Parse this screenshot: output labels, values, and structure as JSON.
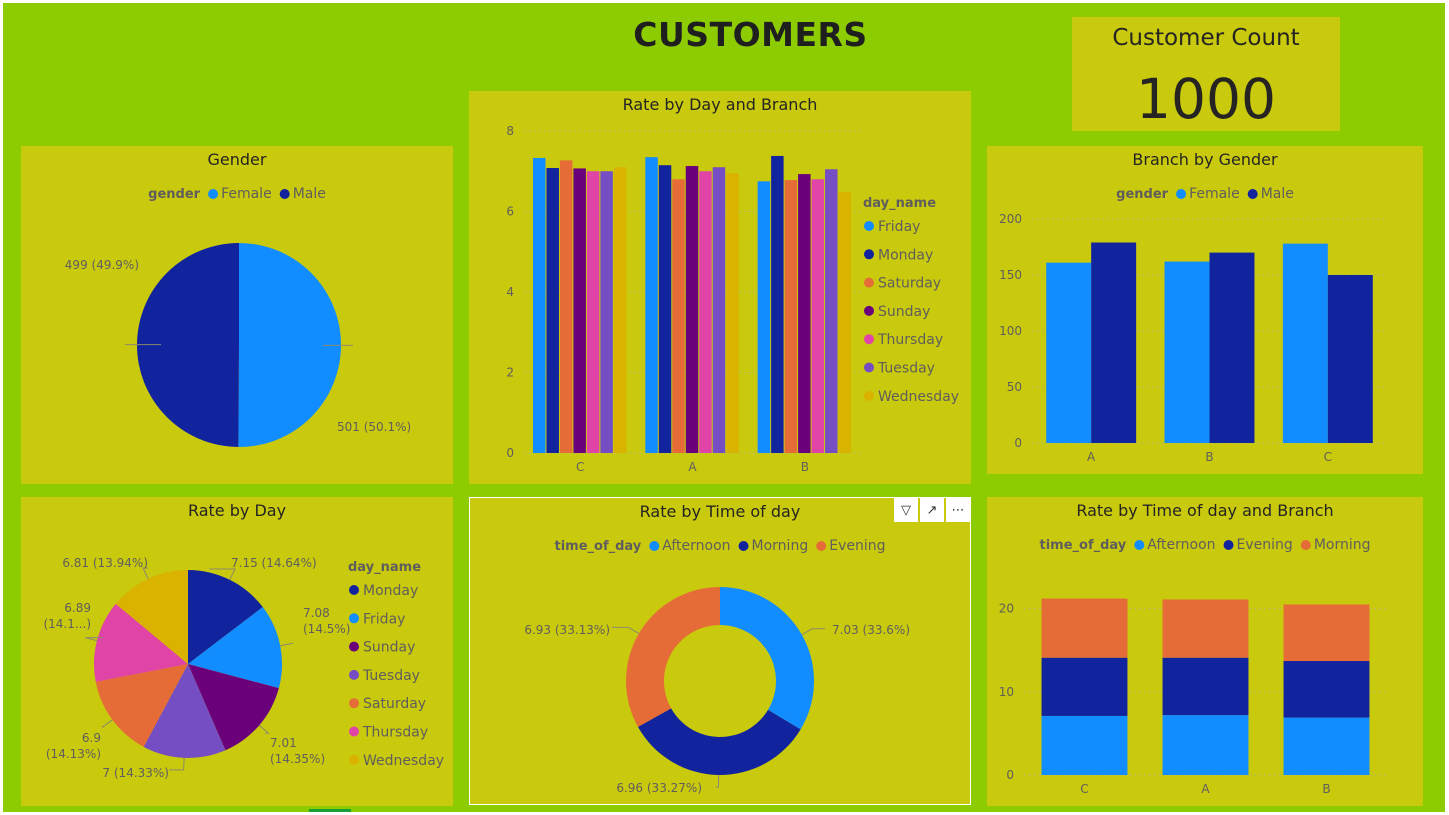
{
  "page": {
    "title": "CUSTOMERS"
  },
  "colors": {
    "light_blue": "#118dff",
    "dark_blue": "#12239e",
    "orange": "#e66c37",
    "purple": "#6b007b",
    "pink": "#e044a7",
    "violet": "#744ec2",
    "gold": "#d9b300"
  },
  "card": {
    "label": "Customer Count",
    "value": "1000"
  },
  "chart_data": [
    {
      "id": "gender",
      "type": "pie",
      "title": "Gender",
      "legend_title": "gender",
      "legend_position": "top",
      "slices": [
        {
          "name": "Female",
          "value": 501,
          "label": "501 (50.1%)",
          "color": "#118dff"
        },
        {
          "name": "Male",
          "value": 499,
          "label": "499 (49.9%)",
          "color": "#12239e"
        }
      ]
    },
    {
      "id": "rate_by_day_branch",
      "type": "bar",
      "title": "Rate by Day and Branch",
      "legend_title": "day_name",
      "legend_position": "right",
      "categories": [
        "C",
        "A",
        "B"
      ],
      "ylim": [
        0,
        8
      ],
      "yticks": [
        0,
        2,
        4,
        6,
        8
      ],
      "grid": true,
      "series": [
        {
          "name": "Friday",
          "color": "#118dff",
          "values": [
            7.33,
            7.35,
            6.75
          ]
        },
        {
          "name": "Monday",
          "color": "#12239e",
          "values": [
            7.08,
            7.15,
            7.38
          ]
        },
        {
          "name": "Saturday",
          "color": "#e66c37",
          "values": [
            7.27,
            6.8,
            6.78
          ]
        },
        {
          "name": "Sunday",
          "color": "#6b007b",
          "values": [
            7.07,
            7.13,
            6.93
          ]
        },
        {
          "name": "Thursday",
          "color": "#e044a7",
          "values": [
            7.0,
            7.0,
            6.8
          ]
        },
        {
          "name": "Tuesday",
          "color": "#744ec2",
          "values": [
            7.0,
            7.1,
            7.05
          ]
        },
        {
          "name": "Wednesday",
          "color": "#d9b300",
          "values": [
            7.1,
            6.95,
            6.48
          ]
        }
      ]
    },
    {
      "id": "branch_by_gender",
      "type": "bar",
      "title": "Branch by Gender",
      "legend_title": "gender",
      "legend_position": "top",
      "categories": [
        "A",
        "B",
        "C"
      ],
      "ylim": [
        0,
        200
      ],
      "yticks": [
        0,
        50,
        100,
        150,
        200
      ],
      "grid": true,
      "series": [
        {
          "name": "Female",
          "color": "#118dff",
          "values": [
            161,
            162,
            178
          ]
        },
        {
          "name": "Male",
          "color": "#12239e",
          "values": [
            179,
            170,
            150
          ]
        }
      ]
    },
    {
      "id": "rate_by_day",
      "type": "pie",
      "title": "Rate by Day",
      "legend_title": "day_name",
      "legend_position": "right",
      "slices": [
        {
          "name": "Monday",
          "value": 7.15,
          "label": "7.15 (14.64%)",
          "color": "#12239e"
        },
        {
          "name": "Friday",
          "value": 7.08,
          "label": "7.08 (14.5%)",
          "color": "#118dff"
        },
        {
          "name": "Sunday",
          "value": 7.01,
          "label": "7.01 (14.35%)",
          "color": "#6b007b"
        },
        {
          "name": "Tuesday",
          "value": 7.0,
          "label": "7 (14.33%)",
          "color": "#744ec2"
        },
        {
          "name": "Saturday",
          "value": 6.9,
          "label": "6.9 (14.13%)",
          "color": "#e66c37"
        },
        {
          "name": "Thursday",
          "value": 6.89,
          "label": "6.89 (14.1...)",
          "color": "#e044a7"
        },
        {
          "name": "Wednesday",
          "value": 6.81,
          "label": "6.81 (13.94%)",
          "color": "#d9b300"
        }
      ]
    },
    {
      "id": "rate_by_time",
      "type": "pie",
      "donut": true,
      "title": "Rate by Time of day",
      "legend_title": "time_of_day",
      "legend_position": "top",
      "slices": [
        {
          "name": "Afternoon",
          "value": 7.03,
          "label": "7.03 (33.6%)",
          "color": "#118dff"
        },
        {
          "name": "Morning",
          "value": 6.96,
          "label": "6.96 (33.27%)",
          "color": "#12239e"
        },
        {
          "name": "Evening",
          "value": 6.93,
          "label": "6.93 (33.13%)",
          "color": "#e66c37"
        }
      ]
    },
    {
      "id": "rate_by_time_branch",
      "type": "bar",
      "stacked": true,
      "title": "Rate by Time of day and Branch",
      "legend_title": "time_of_day",
      "legend_position": "top",
      "categories": [
        "C",
        "A",
        "B"
      ],
      "ylim": [
        0,
        25
      ],
      "yticks": [
        0,
        10,
        20
      ],
      "grid": true,
      "series": [
        {
          "name": "Afternoon",
          "color": "#118dff",
          "values": [
            7.1,
            7.2,
            6.9
          ]
        },
        {
          "name": "Evening",
          "color": "#12239e",
          "values": [
            7.0,
            6.9,
            6.8
          ]
        },
        {
          "name": "Morning",
          "color": "#e66c37",
          "values": [
            7.1,
            7.0,
            6.8
          ]
        }
      ]
    }
  ]
}
